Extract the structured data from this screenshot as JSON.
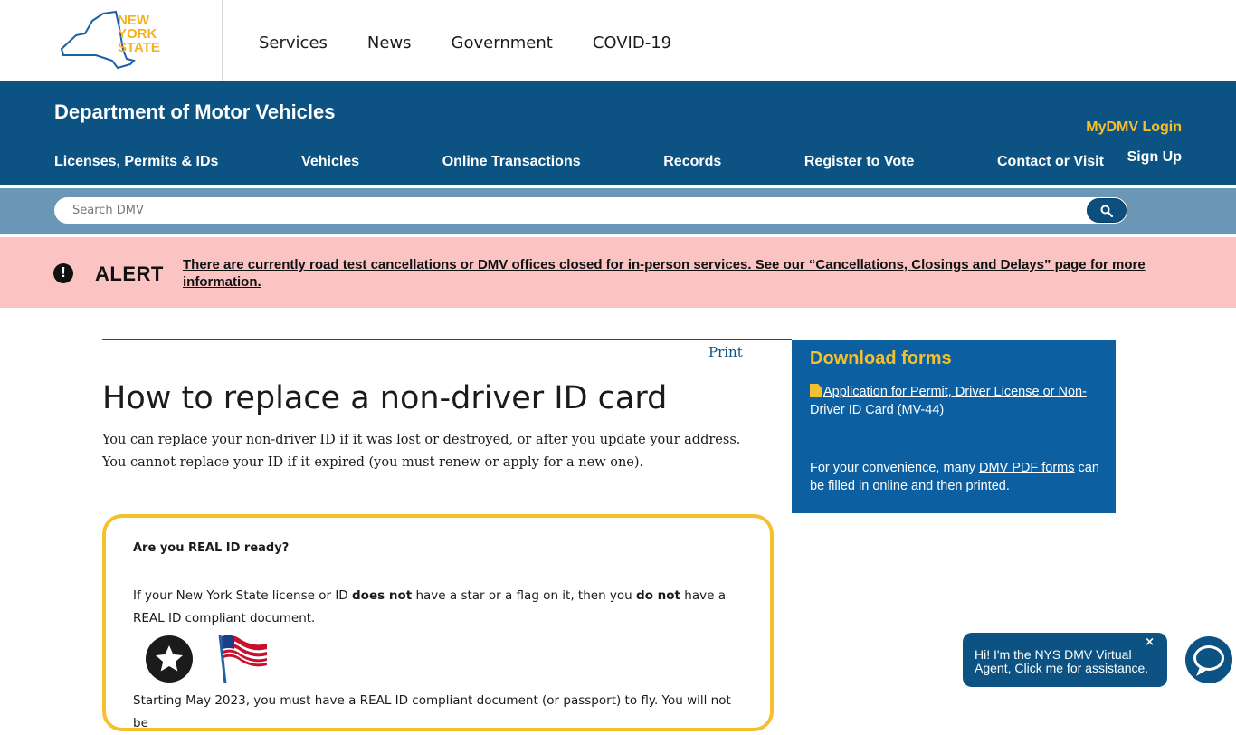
{
  "state_header": {
    "logo_text": "NEW YORK STATE",
    "nav": [
      {
        "label": "Services"
      },
      {
        "label": "News"
      },
      {
        "label": "Government"
      },
      {
        "label": "COVID-19"
      }
    ]
  },
  "dmv_header": {
    "title": "Department of Motor Vehicles",
    "mydmv_login": "MyDMV Login",
    "sign_up": "Sign Up",
    "nav": [
      {
        "label": "Licenses, Permits & IDs"
      },
      {
        "label": "Vehicles"
      },
      {
        "label": "Online Transactions"
      },
      {
        "label": "Records"
      },
      {
        "label": "Register to Vote"
      },
      {
        "label": "Contact or Visit"
      }
    ]
  },
  "search": {
    "placeholder": "Search DMV",
    "icon": "search-icon"
  },
  "alert": {
    "label": "ALERT",
    "icon": "exclamation-icon",
    "message": "There are currently road test cancellations or DMV offices closed for in-person services. See our “Cancellations, Closings and Delays” page for more information."
  },
  "main": {
    "print_label": "Print",
    "title": "How to replace a non-driver ID card",
    "intro": "You can replace your non-driver ID if it was lost or destroyed, or after you update your address. You cannot replace your ID if it expired (you must renew or apply for a new one).",
    "realid": {
      "question": "Are you REAL ID ready?",
      "p_part1": "If your New York State license or ID ",
      "p_bold1": "does not",
      "p_part2": " have a star or a flag on it, then you ",
      "p_bold2": "do not",
      "p_part3": " have a REAL ID compliant document.",
      "cut_text": "Starting May 2023, you must have a REAL ID compliant document (or passport) to fly. You will not be"
    }
  },
  "sidebar": {
    "title": "Download forms",
    "form_link": "Application for Permit, Driver License or Non-Driver ID Card (MV-44)",
    "note_prefix": "For your convenience, many ",
    "note_link": "DMV PDF forms",
    "note_suffix": " can be filled in online and then printed."
  },
  "chat": {
    "message": "Hi! I'm the NYS DMV Virtual Agent, Click me for assistance.",
    "close": "×"
  },
  "colors": {
    "dmv_blue": "#0c5384",
    "sidebar_blue": "#0c5fa0",
    "search_strip": "#6a97b5",
    "alert_bg": "#fbc4c3",
    "accent_gold": "#f5c02d"
  }
}
